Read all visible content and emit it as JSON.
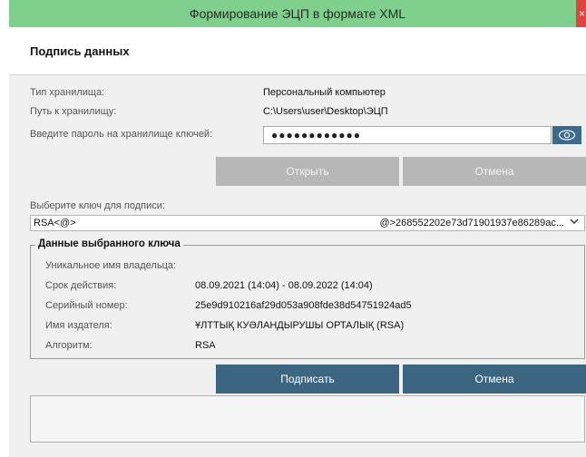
{
  "window": {
    "title": "Формирование ЭЦП в формате XML",
    "close_glyph": "×"
  },
  "header": {
    "title": "Подпись данных"
  },
  "storage": {
    "type_label": "Тип хранилища:",
    "type_value": "Персональный компьютер",
    "path_label": "Путь к хранилищу:",
    "path_value": "C:\\Users\\user\\Desktop\\ЭЦП",
    "password_label": "Введите пароль на хранилище ключей:",
    "password_value": "●●●●●●●●●●●●"
  },
  "buttons_top": {
    "open_label": "Открыть",
    "cancel_label": "Отмена"
  },
  "key_select": {
    "label": "Выберите ключ для подписи:",
    "selected_left": "RSA<@>",
    "selected_right": "@>268552202e73d71901937e86289ac..."
  },
  "key_details": {
    "title": "Данные выбранного ключа",
    "rows": [
      {
        "label": "Уникальное имя владельца:",
        "value": ""
      },
      {
        "label": "Срок действия:",
        "value": "08.09.2021 (14:04) - 08.09.2022 (14:04)"
      },
      {
        "label": "Серийный номер:",
        "value": "25e9d910216af29d053a908fde38d54751924ad5"
      },
      {
        "label": "Имя издателя:",
        "value": "ҰЛТТЫҚ КУӘЛАНДЫРУШЫ ОРТАЛЫҚ (RSA)"
      },
      {
        "label": "Алгоритм:",
        "value": "RSA"
      }
    ]
  },
  "buttons_bottom": {
    "sign_label": "Подписать",
    "cancel_label": "Отмена"
  },
  "colors": {
    "titlebar": "#7fcf8d",
    "primary": "#3b6581",
    "disabled": "#b7b7b7"
  },
  "icons": {
    "password_toggle": "eye-icon",
    "dropdown": "chevron-down-icon"
  }
}
